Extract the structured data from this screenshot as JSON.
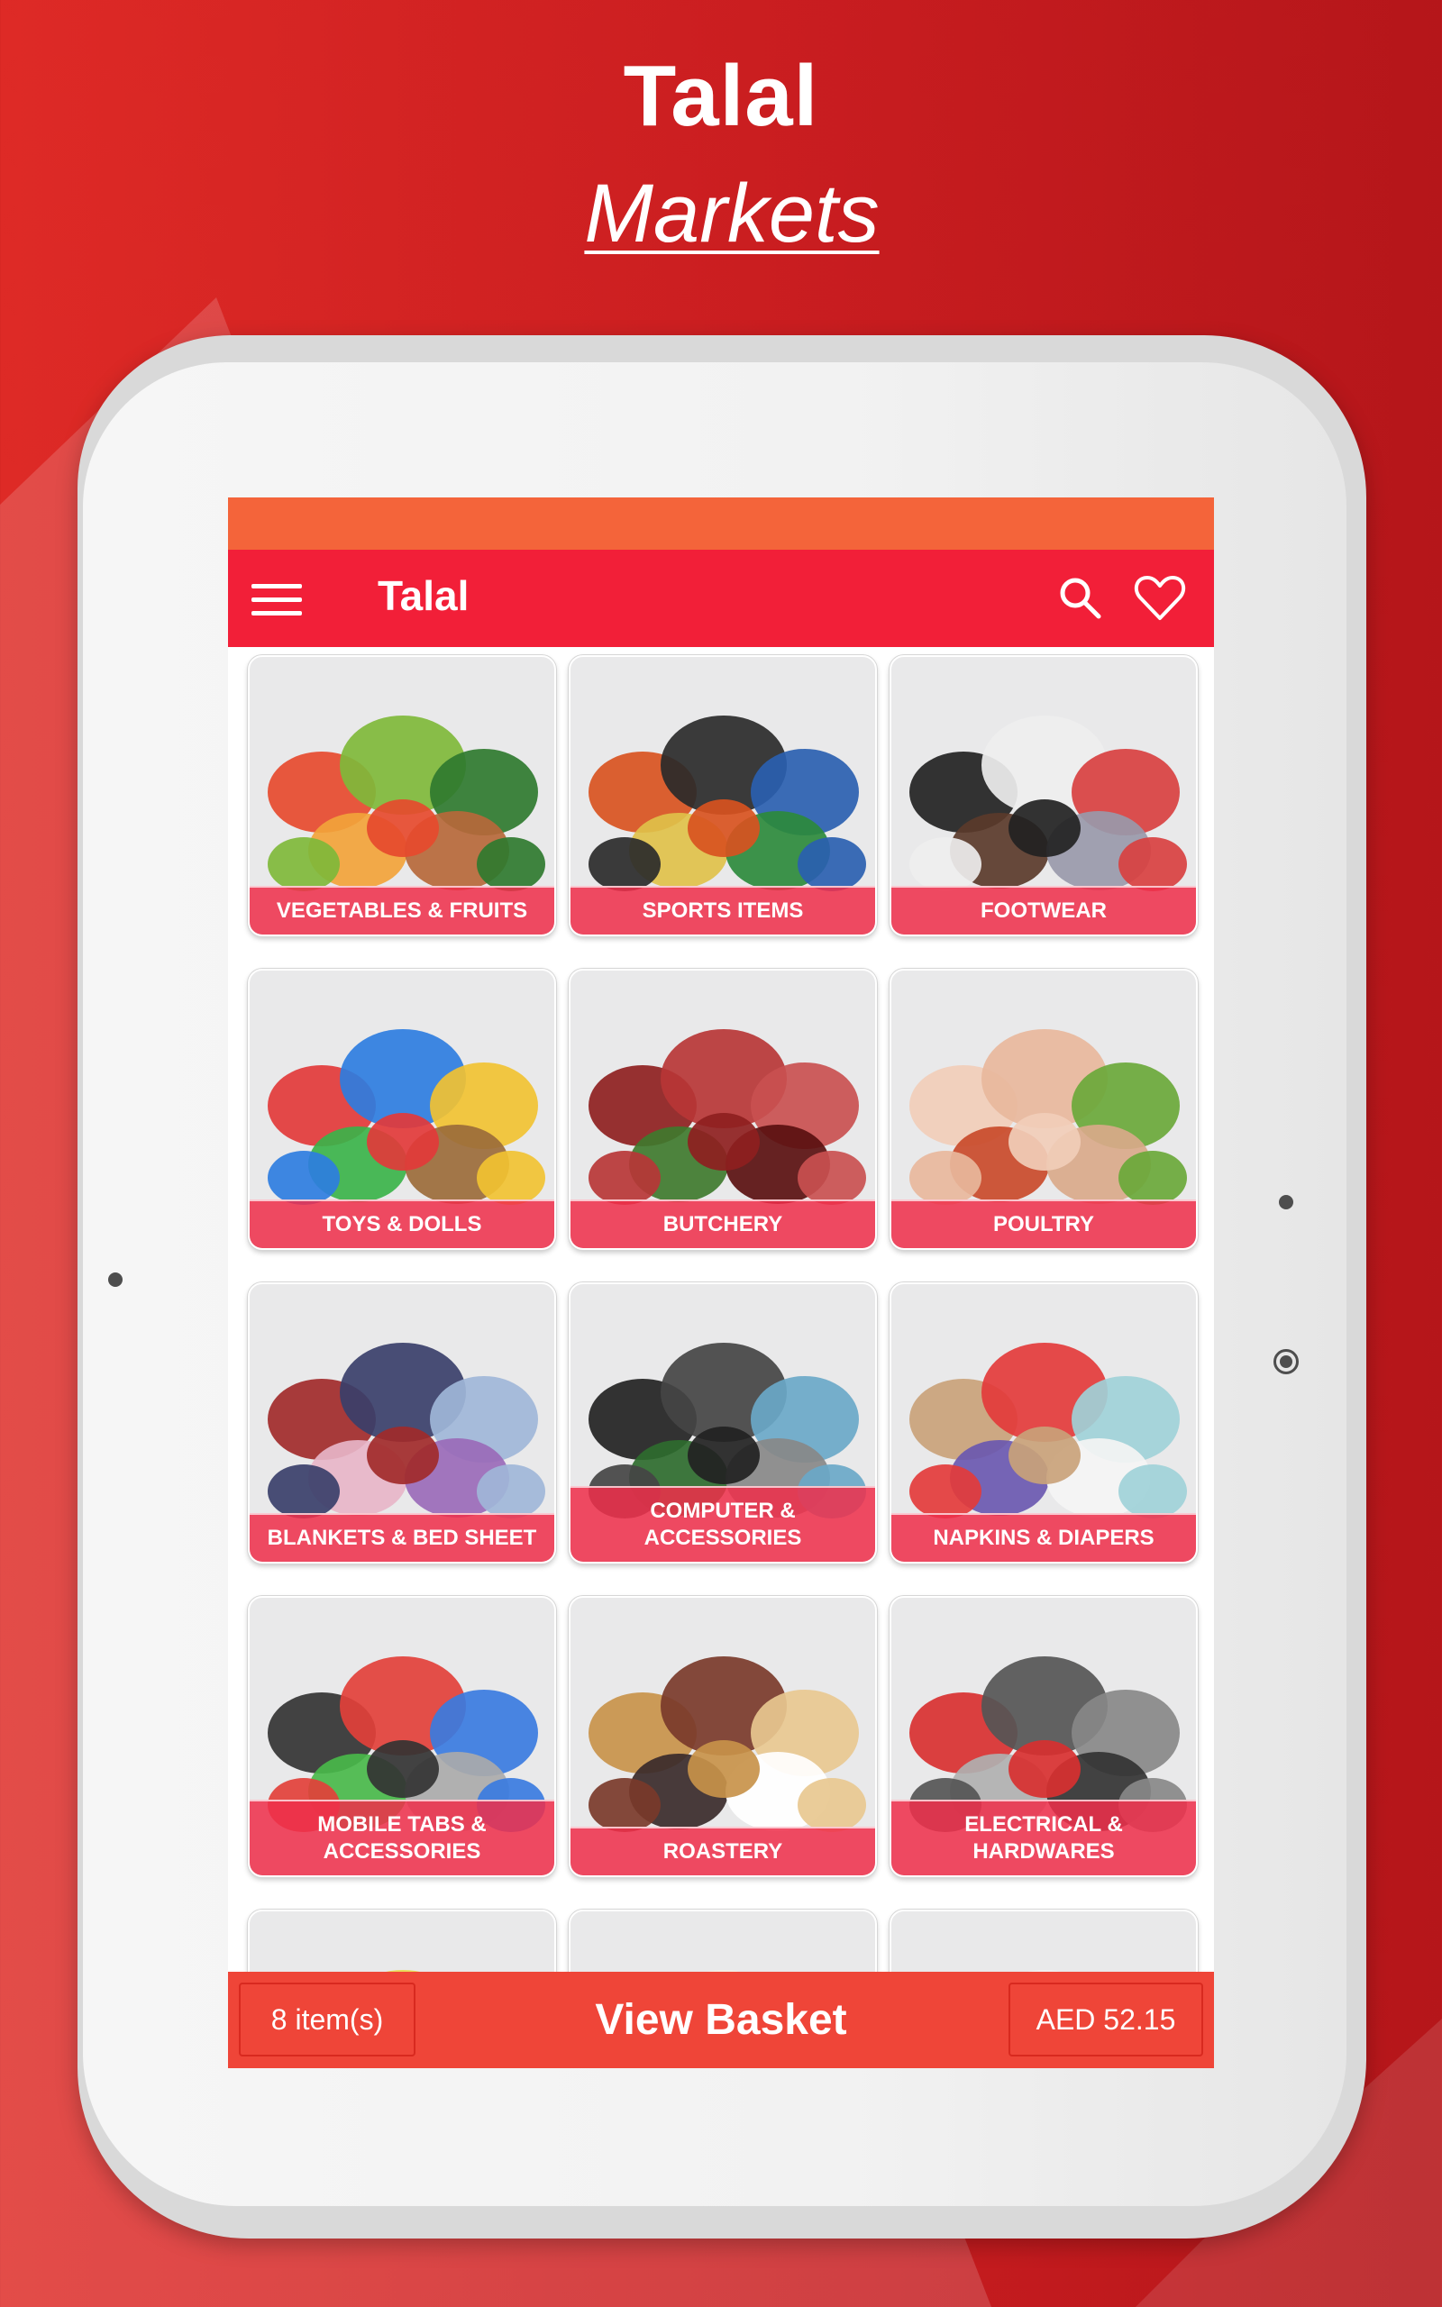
{
  "hero": {
    "title": "Talal",
    "subtitle": "Markets"
  },
  "colors": {
    "status_bar": "#F4643A",
    "toolbar": "#F21F38",
    "card_label": "#EF2F4A",
    "basket_bar": "#EF4538",
    "background": "#C91D20"
  },
  "toolbar": {
    "title": "Talal",
    "menu_icon": "hamburger-menu-icon",
    "search_icon": "search-icon",
    "favorites_icon": "heart-icon"
  },
  "categories": [
    {
      "label": "VEGETABLES & FRUITS",
      "image": "vegetables-fruits-basket"
    },
    {
      "label": "SPORTS ITEMS",
      "image": "sports-equipment"
    },
    {
      "label": "FOOTWEAR",
      "image": "shoes-socks-sandals"
    },
    {
      "label": "TOYS & DOLLS",
      "image": "toys-stuffed-animals"
    },
    {
      "label": "BUTCHERY",
      "image": "raw-meat-cuts"
    },
    {
      "label": "POULTRY",
      "image": "raw-chicken"
    },
    {
      "label": "BLANKETS & BED SHEET",
      "image": "rolled-blankets"
    },
    {
      "label": "COMPUTER & ACCESSORIES",
      "image": "computer-peripherals"
    },
    {
      "label": "NAPKINS & DIAPERS",
      "image": "diaper-packs"
    },
    {
      "label": "MOBILE TABS & ACCESSORIES",
      "image": "phones-accessories"
    },
    {
      "label": "ROASTERY",
      "image": "bowl-of-nuts"
    },
    {
      "label": "ELECTRICAL & HARDWARES",
      "image": "hand-tools"
    },
    {
      "label": "",
      "image": "packaged-product"
    },
    {
      "label": "",
      "image": "juice-milk-bottles"
    },
    {
      "label": "",
      "image": "shirts-on-hangers"
    }
  ],
  "basket": {
    "items": "8 item(s)",
    "action": "View Basket",
    "total": "AED 52.15"
  }
}
